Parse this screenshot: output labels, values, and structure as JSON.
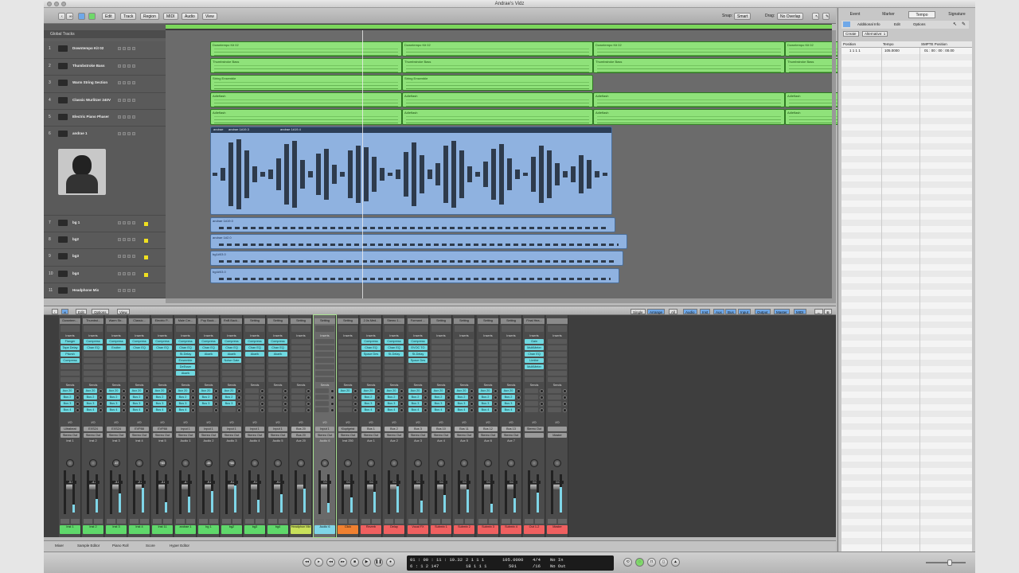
{
  "window": {
    "title": "Andrae's Vidz"
  },
  "toolbar": {
    "menus": [
      "Edit",
      "Track",
      "Region",
      "MIDI",
      "Audio",
      "View"
    ],
    "snap_label": "Snap:",
    "snap_value": "Smart",
    "drag_label": "Drag:",
    "drag_value": "No Overlap"
  },
  "sidebar": {
    "tabs": [
      "Event",
      "Marker",
      "Tempo",
      "Signature"
    ],
    "active_tab": "Tempo",
    "subtabs": [
      "Additional Info",
      "Edit",
      "Options"
    ],
    "buttons": [
      "Create",
      "Alternative: 1"
    ],
    "columns": [
      "Position",
      "Tempo",
      "SMPTE Position"
    ],
    "row": [
      "1 1 1 1",
      "105.0000",
      "01 : 00 : 00 : 00.00"
    ]
  },
  "tracklist": {
    "global_label": "Global Tracks",
    "tracks": [
      {
        "num": "1",
        "name": "Downtempo Kit 02"
      },
      {
        "num": "2",
        "name": "Thumbstroke Bass"
      },
      {
        "num": "3",
        "name": "Warm String Section"
      },
      {
        "num": "4",
        "name": "Classic Wurlitzer 240V"
      },
      {
        "num": "5",
        "name": "Electric Piano Phaser"
      },
      {
        "num": "6",
        "name": "andrae 1"
      },
      {
        "num": "7",
        "name": "bg 1"
      },
      {
        "num": "8",
        "name": "bg2"
      },
      {
        "num": "9",
        "name": "bg3"
      },
      {
        "num": "10",
        "name": "bg4"
      },
      {
        "num": "11",
        "name": "Headphone Mix"
      }
    ]
  },
  "regions": {
    "r1": [
      "Downtempo Kit 02",
      "Downtempo Kit 02",
      "Downtempo Kit 02",
      "Downtempo Kit 02"
    ],
    "r2": [
      "Thumbstroke Bass",
      "Thumbstroke Bass",
      "Thumbstroke Bass",
      "Thumbstroke Bass"
    ],
    "r3": [
      "String Ensemble",
      "String Ensemble"
    ],
    "r4": [
      "Adleflash",
      "Adleflash",
      "Adleflash",
      "Adleflash"
    ],
    "r5": [
      "Adleflash",
      "Adleflash",
      "Adleflash",
      "Adleflash"
    ],
    "r6": [
      "andrae",
      "andrae 1#19.3",
      "andrae 1#19.4"
    ],
    "r7": "andrae 1#19.0",
    "r8": "andrae 1#2.0",
    "r9": "bg1#03.0",
    "r10": "bg4#03.0"
  },
  "mixer_bar": {
    "menus": [
      "Edit",
      "Options",
      "View"
    ],
    "views": [
      "Single",
      "Arrange",
      "All"
    ],
    "filters": [
      "Audio",
      "Inst",
      "Aux",
      "Bus",
      "Input",
      "Output",
      "Master",
      "MIDI"
    ]
  },
  "mixer": {
    "labels": {
      "inserts": "Inserts",
      "sends": "Sends",
      "io": "I/O",
      "eq": "EQ"
    },
    "strips": [
      {
        "name": "Downtem...",
        "ins": [
          "Flanger",
          "Tape Delay",
          "Pitcrsh",
          "Compress"
        ],
        "sends": [
          "Aux 20",
          "Bus 2",
          "Bus 3",
          "Bus 4"
        ],
        "io": [
          "Ultrabeat",
          "Stereo Out"
        ],
        "grp": "Inst 1",
        "pan": "",
        "vol": "-5.0",
        "bottom": "Inst 1",
        "bcolor": "#5fd86a"
      },
      {
        "name": "Thumbst...",
        "ins": [
          "Compress",
          "Chan EQ"
        ],
        "sends": [
          "Aux 20",
          "Bus 2",
          "Bus 3",
          "Bus 4"
        ],
        "io": [
          "EXS24",
          "Stereo Out"
        ],
        "grp": "Inst 2",
        "pan": "",
        "vol": "-4.2",
        "bottom": "Inst 2",
        "bcolor": "#5fd86a"
      },
      {
        "name": "Warm Str...",
        "ins": [
          "Compress",
          "Exciter"
        ],
        "sends": [
          "Aux 20",
          "Bus 2",
          "Bus 3",
          "Bus 4"
        ],
        "io": [
          "EXS24",
          "Stereo Out"
        ],
        "grp": "Inst 3",
        "pan": "-17",
        "vol": "-3.8",
        "bottom": "Inst 3",
        "bcolor": "#5fd86a"
      },
      {
        "name": "Classic...",
        "ins": [
          "Compress",
          "Chan EQ"
        ],
        "sends": [
          "Aux 20",
          "Bus 2",
          "Bus 3",
          "Bus 4"
        ],
        "io": [
          "EVP88",
          "Stereo Out"
        ],
        "grp": "Inst 4",
        "pan": "",
        "vol": "-2.2",
        "bottom": "Inst 4",
        "bcolor": "#5fd86a"
      },
      {
        "name": "Electric P...",
        "ins": [
          "Compress",
          "Chan EQ"
        ],
        "sends": [
          "Aux 20",
          "Bus 2",
          "Bus 3",
          "Bus 4"
        ],
        "io": [
          "EVP88",
          "Stereo Out"
        ],
        "grp": "Inst 5",
        "pan": "+43",
        "vol": "-3.8",
        "bottom": "Inst 11",
        "bcolor": "#5fd86a"
      },
      {
        "name": "Male Cre...",
        "ins": [
          "Compress",
          "Chan EQ",
          "St-Delay",
          "Ensemble",
          "DeEsser",
          "Akarik"
        ],
        "sends": [
          "Aux 20",
          "Bus 2",
          "Bus 3",
          "Bus 4"
        ],
        "io": [
          "Input 1",
          "Stereo Out"
        ],
        "grp": "Audio 1",
        "pan": "",
        "vol": "-4.1",
        "bottom": "andrae 1",
        "bcolor": "#5fd86a"
      },
      {
        "name": "Pop Back...",
        "ins": [
          "Compress",
          "Chan EQ",
          "Akarik"
        ],
        "sends": [
          "Aux 20",
          "Bus 2",
          "Bus 3"
        ],
        "io": [
          "Input 1",
          "Stereo Out"
        ],
        "grp": "Audio 2",
        "pan": "-44",
        "vol": "-9.8",
        "bottom": "bg 1",
        "bcolor": "#5fd86a"
      },
      {
        "name": "RnB Back...",
        "ins": [
          "Compress",
          "Chan EQ",
          "Akarik",
          "Noise Gate"
        ],
        "sends": [
          "Aux 20",
          "Bus 2",
          "Bus 3"
        ],
        "io": [
          "Input 1",
          "Stereo Out"
        ],
        "grp": "Audio 3",
        "pan": "+44",
        "vol": "-9.8",
        "bottom": "bg2",
        "bcolor": "#5fd86a"
      },
      {
        "name": "Setting",
        "ins": [
          "Compress",
          "Chan EQ",
          "Akarik"
        ],
        "sends": [],
        "io": [
          "Input 1",
          "Stereo Out"
        ],
        "grp": "Audio 4",
        "pan": "",
        "vol": "-9.8",
        "bottom": "bg3",
        "bcolor": "#5fd86a"
      },
      {
        "name": "Setting",
        "ins": [
          "Compress",
          "Chan EQ",
          "Akarik"
        ],
        "sends": [],
        "io": [
          "Input 1",
          "Stereo Out"
        ],
        "grp": "Audio 5",
        "pan": "",
        "vol": "-9.8",
        "bottom": "bg4",
        "bcolor": "#5fd86a"
      },
      {
        "name": "Setting",
        "ins": [],
        "sends": [],
        "io": [
          "Bus 20",
          "Bus 20"
        ],
        "grp": "Aux 20",
        "pan": "",
        "vol": "",
        "bottom": "Headphon Mix",
        "bcolor": "#c8e05a"
      },
      {
        "name": "Setting",
        "ins": [],
        "sends": [],
        "io": [
          "Input 1",
          "Stereo Out"
        ],
        "grp": "Audio 6",
        "pan": "",
        "vol": "0.0",
        "bottom": "Audio 6",
        "bcolor": "#7fd6e8"
      },
      {
        "name": "Setting",
        "ins": [],
        "sends": [
          "Aux 20"
        ],
        "io": [
          "Klopfgeist",
          "Stereo Out"
        ],
        "grp": "Inst 250",
        "pan": "",
        "vol": "0.0",
        "bottom": "Click",
        "bcolor": "#f08030"
      },
      {
        "name": "2.0s Med...",
        "ins": [
          "Compress",
          "Chan EQ",
          "Space Des"
        ],
        "sends": [
          "Aux 20",
          "Bus 2",
          "Bus 3",
          "Bus 4"
        ],
        "io": [
          "Bus 1",
          "Stereo Out"
        ],
        "grp": "Aux 1",
        "pan": "",
        "vol": "0.0",
        "bottom": "Reverb",
        "bcolor": "#f06060"
      },
      {
        "name": "Stereo 1...",
        "ins": [
          "Compress",
          "Chan EQ",
          "St-Delay"
        ],
        "sends": [
          "Aux 20",
          "Bus 2",
          "Bus 3",
          "Bus 4"
        ],
        "io": [
          "Bus 2",
          "Stereo Out"
        ],
        "grp": "Aux 2",
        "pan": "",
        "vol": "0.0",
        "bottom": "Delay",
        "bcolor": "#f06060"
      },
      {
        "name": "Formant ...",
        "ins": [
          "Compress",
          "EVOC TO",
          "St-Delay",
          "Space Des"
        ],
        "sends": [
          "Aux 20",
          "Bus 2",
          "Bus 3",
          "Bus 4"
        ],
        "io": [
          "Bus 3",
          "Stereo Out"
        ],
        "grp": "Aux 3",
        "pan": "",
        "vol": "0.0",
        "bottom": "Vocal FX",
        "bcolor": "#f06060"
      },
      {
        "name": "Setting",
        "ins": [],
        "sends": [
          "Aux 20",
          "Bus 2",
          "Bus 3",
          "Bus 4"
        ],
        "io": [
          "Bus 10",
          "Stereo Out"
        ],
        "grp": "Aux 4",
        "pan": "",
        "vol": "0.0",
        "bottom": "Submix 1",
        "bcolor": "#f06060"
      },
      {
        "name": "Setting",
        "ins": [],
        "sends": [
          "Aux 20",
          "Bus 2",
          "Bus 3",
          "Bus 4"
        ],
        "io": [
          "Bus 11",
          "Stereo Out"
        ],
        "grp": "Aux 5",
        "pan": "",
        "vol": "0.0",
        "bottom": "Submix 2",
        "bcolor": "#f06060"
      },
      {
        "name": "Setting",
        "ins": [],
        "sends": [
          "Aux 20",
          "Bus 2",
          "Bus 3",
          "Bus 4"
        ],
        "io": [
          "Bus 12",
          "Stereo Out"
        ],
        "grp": "Aux 6",
        "pan": "",
        "vol": "0.0",
        "bottom": "Submix 3",
        "bcolor": "#f06060"
      },
      {
        "name": "Setting",
        "ins": [],
        "sends": [
          "Aux 20",
          "Bus 2",
          "Bus 3",
          "Bus 4"
        ],
        "io": [
          "Bus 13",
          "Stereo Out"
        ],
        "grp": "Aux 7",
        "pan": "",
        "vol": "0.0",
        "bottom": "Submix 4",
        "bcolor": "#f06060"
      },
      {
        "name": "Final Hea...",
        "ins": [
          "Gain",
          "MultiMeter",
          "Chan EQ",
          "Limiter",
          "MultiMeter"
        ],
        "sends": [],
        "io": [
          "Stereo Out",
          ""
        ],
        "grp": "",
        "pan": "",
        "vol": "0.0",
        "bottom": "Out 1-2",
        "bcolor": "#f06060"
      },
      {
        "name": "",
        "ins": [],
        "sends": [],
        "io": [
          "",
          "Master"
        ],
        "grp": "",
        "pan": "",
        "vol": "0.0",
        "bottom": "Master",
        "bcolor": "#f06060"
      }
    ]
  },
  "bottom_tabs": [
    "Mixer",
    "Sample Editor",
    "Piano Roll",
    "Score",
    "Hyper Editor"
  ],
  "transport": {
    "smpte": "01 : 00 : 11 : 19.32",
    "smpte_sub": "6 : 1 2 147",
    "bars": "2  1  1  1",
    "bars_sub": "18  1  1  1",
    "tempo": "105.0000",
    "tempo_sub": "501",
    "sig": "4/4",
    "sig_sub": "/16",
    "in": "No In",
    "out": "No Out"
  }
}
